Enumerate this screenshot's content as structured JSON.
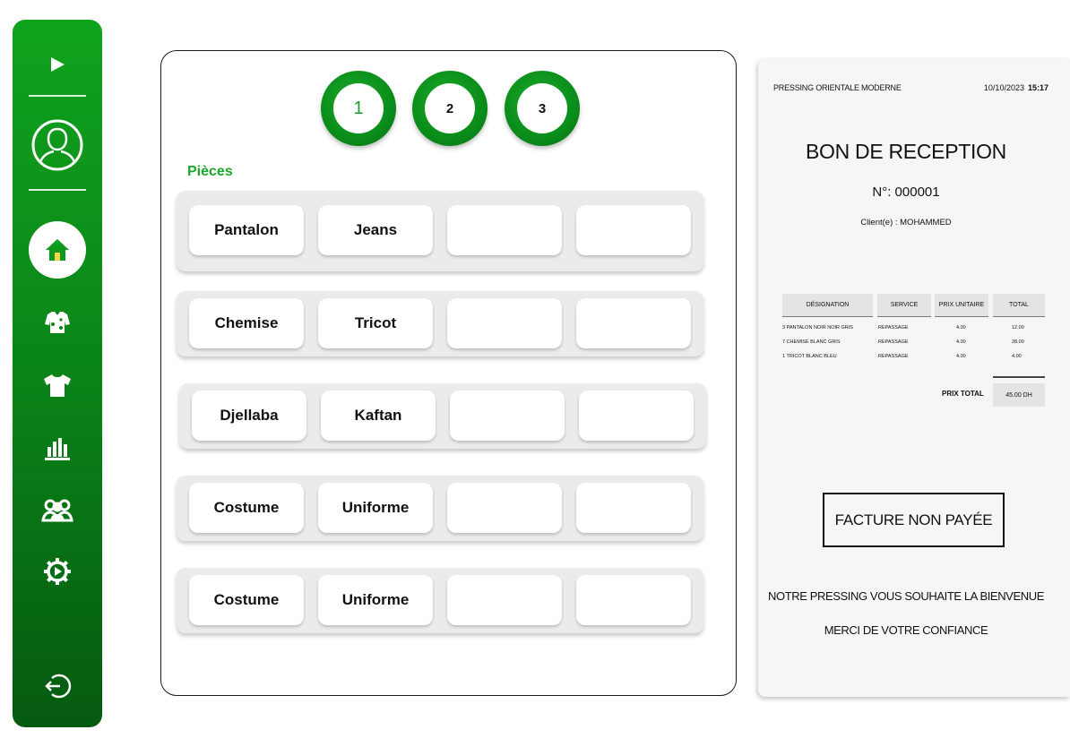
{
  "sidebar": {
    "items": [
      {
        "icon": "play-icon"
      },
      {
        "icon": "user-avatar-icon"
      },
      {
        "icon": "home-icon",
        "active": true
      },
      {
        "icon": "garment-icon"
      },
      {
        "icon": "tshirt-icon"
      },
      {
        "icon": "bar-chart-icon"
      },
      {
        "icon": "users-icon"
      },
      {
        "icon": "settings-icon"
      },
      {
        "icon": "logout-icon"
      }
    ],
    "colors": {
      "accent": "#0a8d1a",
      "light": "#10a31d",
      "dark": "#055a10"
    }
  },
  "steps": [
    {
      "label": "1",
      "active": true
    },
    {
      "label": "2",
      "active": false
    },
    {
      "label": "3",
      "active": false
    }
  ],
  "pieces": {
    "title": "Pièces",
    "rows": [
      [
        "Pantalon",
        "Jeans",
        "",
        ""
      ],
      [
        "Chemise",
        "Tricot",
        "",
        ""
      ],
      [
        "Djellaba",
        "Kaftan",
        "",
        ""
      ],
      [
        "Costume",
        "Uniforme",
        "",
        ""
      ],
      [
        "Costume",
        "Uniforme",
        "",
        ""
      ]
    ]
  },
  "receipt": {
    "company": "PRESSING ORIENTALE MODERNE",
    "date": "10/10/2023",
    "time": "15:17",
    "title": "BON DE RECEPTION",
    "number": "N°: 000001",
    "client": "Client(e) : MOHAMMED",
    "columns": [
      "DÉSIGNATION",
      "SERVICE",
      "PRIX UNITAIRE",
      "TOTAL"
    ],
    "rows": [
      {
        "designation": "3 PANTALON NOIR NOIR GRIS",
        "service": "REPASSAGE",
        "unit_price": "4.00",
        "total": "12.00"
      },
      {
        "designation": "7 CHEMISE BLANC GRIS",
        "service": "REPASSAGE",
        "unit_price": "4.00",
        "total": "28.00"
      },
      {
        "designation": "1 TRICOT BLANC BLEU",
        "service": "REPASSAGE",
        "unit_price": "4.00",
        "total": "4.00"
      }
    ],
    "total_label": "PRIX TOTAL",
    "total_value": "45.00 DH",
    "status": "FACTURE NON PAYÉE",
    "footer_line1": "NOTRE PRESSING VOUS SOUHAITE LA BIENVENUE",
    "footer_line2": "MERCI DE VOTRE CONFIANCE"
  }
}
